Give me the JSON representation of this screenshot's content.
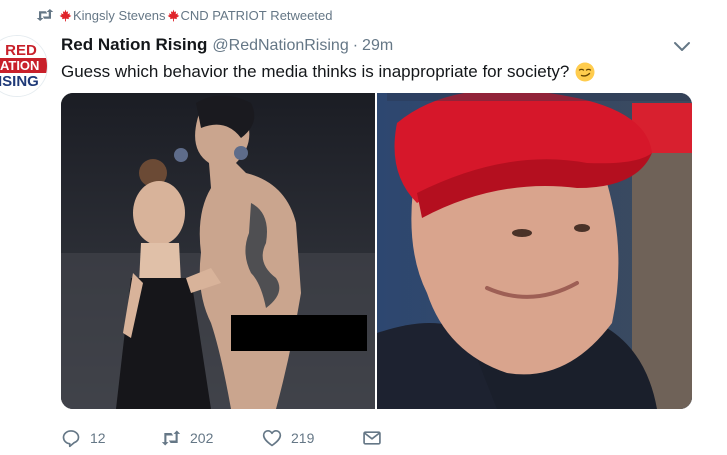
{
  "retweet_context": {
    "retweeter_one": "Kingsly Stevens",
    "retweeter_two": "CND PATRIOT",
    "suffix": " Retweeted",
    "flag_icon": "maple-leaf-icon",
    "flag_color": "#e0242a"
  },
  "author": {
    "avatar_text_lines": [
      "RED",
      "NATION",
      "RISING"
    ],
    "fullname": "Red Nation Rising",
    "username": "@RedNationRising",
    "separator": "·",
    "timestamp": "29m"
  },
  "tweet": {
    "text": "Guess which behavior the media thinks is inappropriate for society?",
    "emoji": "smirking-face-emoji"
  },
  "media": {
    "photos": [
      {
        "description_icon": "photo-left"
      },
      {
        "description_icon": "photo-right"
      }
    ]
  },
  "actions": {
    "reply_count": "12",
    "retweet_count": "202",
    "like_count": "219"
  },
  "colors": {
    "secondary_text": "#657786",
    "primary_text": "#14171a",
    "brand_red": "#c8202a",
    "brand_blue": "#1f3a78"
  }
}
